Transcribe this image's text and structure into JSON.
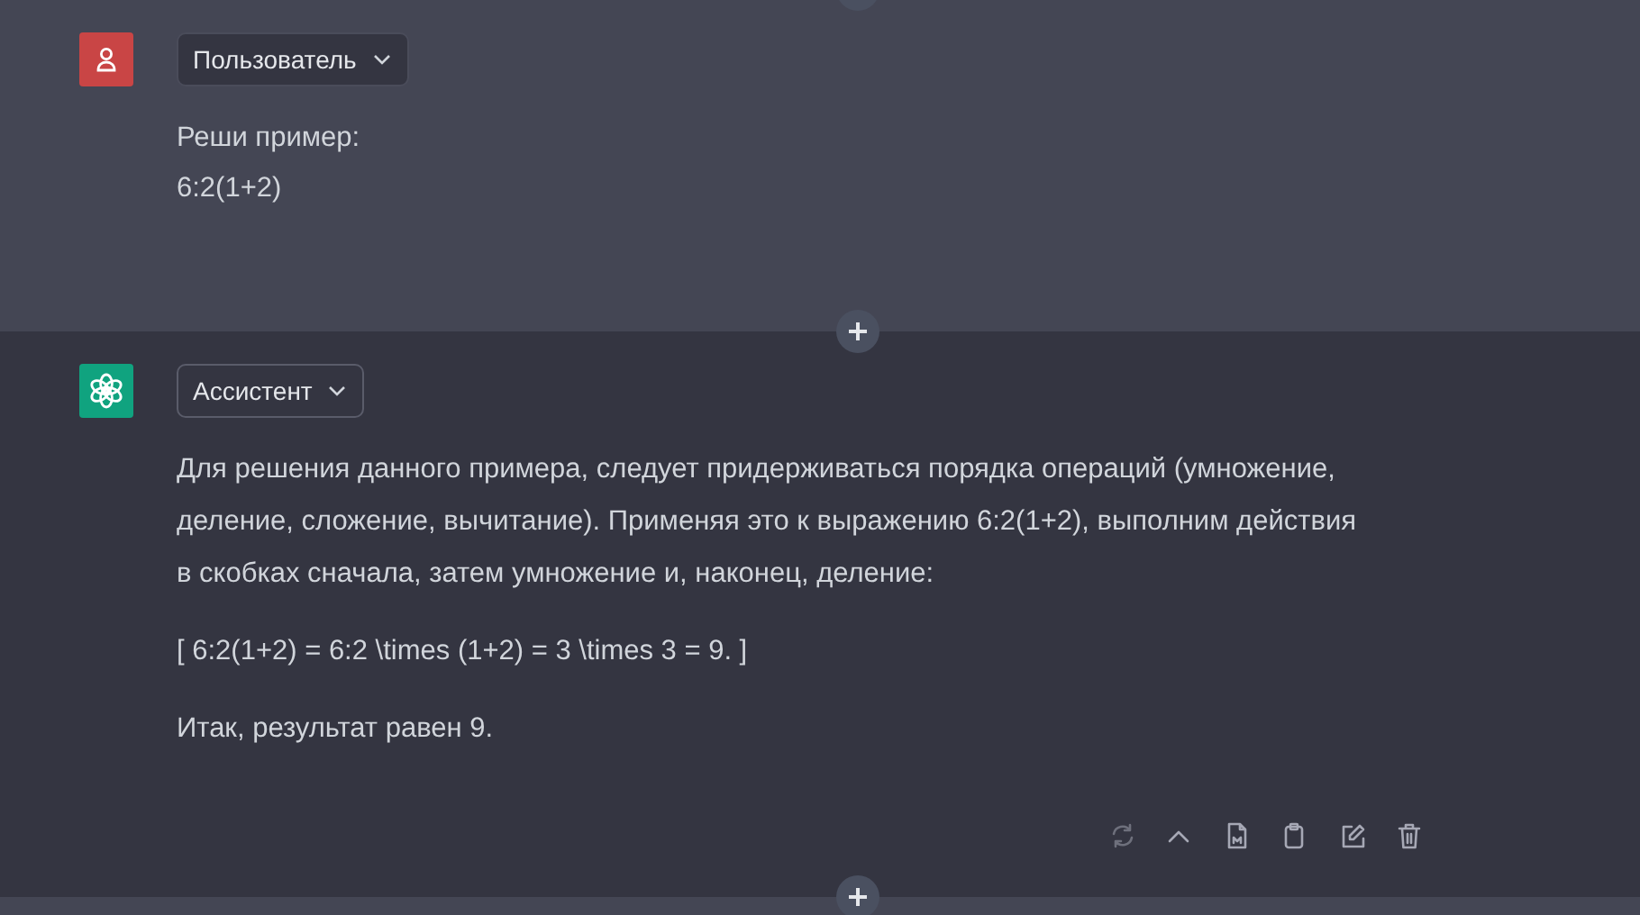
{
  "messages": [
    {
      "kind": "user",
      "author": "Пользователь",
      "paragraphs": [
        "Реши пример:\n6:2(1+2)"
      ]
    },
    {
      "kind": "assistant",
      "author": "Ассистент",
      "paragraphs": [
        "Для решения данного примера, следует придерживаться порядка операций (умножение,\nделение, сложение, вычитание). Применяя это к выражению 6:2(1+2), выполним действия\nв скобках сначала, затем умножение и, наконец, деление:",
        "[ 6:2(1+2) = 6:2 \\times (1+2) = 3 \\times 3 = 9. ]",
        "Итак, результат равен 9."
      ],
      "actions": [
        {
          "kind": "regenerate",
          "disabled": true
        },
        {
          "kind": "collapse",
          "disabled": false
        },
        {
          "kind": "file",
          "disabled": false
        },
        {
          "kind": "copy",
          "disabled": false
        },
        {
          "kind": "edit",
          "disabled": false
        },
        {
          "kind": "delete",
          "disabled": false
        }
      ]
    }
  ]
}
